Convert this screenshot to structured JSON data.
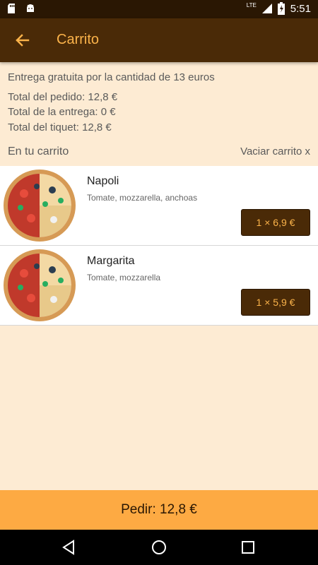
{
  "status_bar": {
    "time": "5:51",
    "network": "LTE"
  },
  "app_bar": {
    "title": "Carrito"
  },
  "summary": {
    "free_delivery": "Entrega gratuita por la cantidad de 13 euros",
    "order_total": "Total del pedido: 12,8 €",
    "delivery_total": "Total de la entrega: 0 €",
    "ticket_total": "Total del tiquet: 12,8 €"
  },
  "cart": {
    "section_label": "En tu carrito",
    "clear_label": "Vaciar carrito x",
    "items": [
      {
        "name": "Napoli",
        "description": "Tomate, mozzarella, anchoas",
        "price": "1 × 6,9 €"
      },
      {
        "name": "Margarita",
        "description": "Tomate, mozzarella",
        "price": "1 × 5,9 €"
      }
    ]
  },
  "order_button": {
    "label": "Pedir: 12,8 €"
  },
  "colors": {
    "appbar": "#4a2a07",
    "accent": "#fbb34a",
    "background": "#fdebd3",
    "order": "#fdaa43"
  }
}
